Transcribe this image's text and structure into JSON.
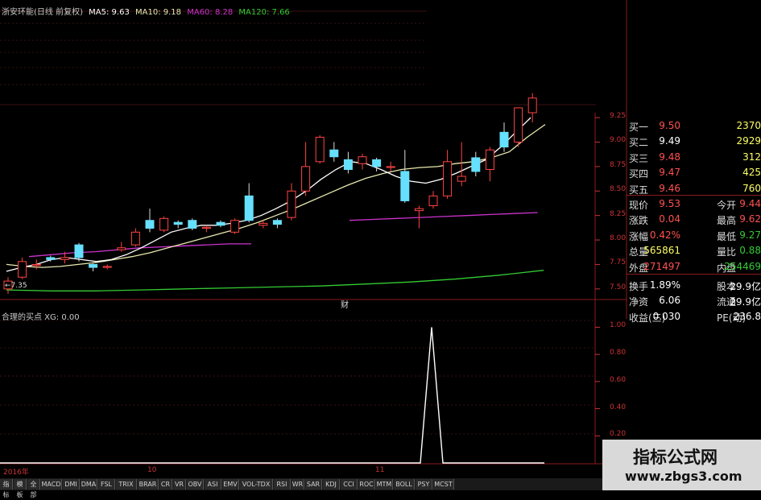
{
  "header": {
    "title": "浙安环能(日线 前复权)",
    "ma5": "MA5: 9.63",
    "ma10": "MA10: 9.18",
    "ma60": "MA60: 8.28",
    "ma120": "MA120: 7.66",
    "colors": {
      "title": "#c8c8c8",
      "ma5": "#ffffff",
      "ma10": "#e8e8b0",
      "ma60": "#cc33cc",
      "ma120": "#33cc33"
    }
  },
  "price_axis": [
    "9.25",
    "9.00",
    "8.75",
    "8.50",
    "8.25",
    "8.00",
    "7.75",
    "7.50"
  ],
  "low_marker": "←7.35",
  "finance_marker": "财",
  "indicator": {
    "title": "合理的买点 XG: 0.00",
    "axis": [
      "1.00",
      "0.80",
      "0.60",
      "0.40",
      "0.20"
    ]
  },
  "time_axis": {
    "year": "2016年",
    "months": [
      "10",
      "11"
    ]
  },
  "order_book": [
    {
      "label": "买一",
      "price": "9.50",
      "volume": "2370",
      "price_color": "#ff5050",
      "volume_color": "#ffff66"
    },
    {
      "label": "买二",
      "price": "9.49",
      "volume": "2929",
      "price_color": "#ffffff",
      "volume_color": "#ffff66"
    },
    {
      "label": "买三",
      "price": "9.48",
      "volume": "312",
      "price_color": "#ff5050",
      "volume_color": "#ffff66"
    },
    {
      "label": "买四",
      "price": "9.47",
      "volume": "425",
      "price_color": "#ff5050",
      "volume_color": "#ffff66"
    },
    {
      "label": "买五",
      "price": "9.46",
      "volume": "760",
      "price_color": "#ff5050",
      "volume_color": "#ffff66"
    }
  ],
  "quote": [
    {
      "l1": "现价",
      "v1": "9.53",
      "l2": "今开",
      "v2": "9.44",
      "c1": "#ff5050",
      "c2": "#ff5050"
    },
    {
      "l1": "涨跌",
      "v1": "0.04",
      "l2": "最高",
      "v2": "9.62",
      "c1": "#ff5050",
      "c2": "#ff5050"
    },
    {
      "l1": "涨幅",
      "v1": "0.42%",
      "l2": "最低",
      "v2": "9.27",
      "c1": "#ff5050",
      "c2": "#33cc33"
    },
    {
      "l1": "总量",
      "v1": "565861",
      "l2": "量比",
      "v2": "0.88",
      "c1": "#ffff66",
      "c2": "#33cc33"
    },
    {
      "l1": "外盘",
      "v1": "271497",
      "l2": "内盘",
      "v2": "254469",
      "c1": "#ff5050",
      "c2": "#33cc33"
    },
    {
      "l1": "换手",
      "v1": "1.89%",
      "l2": "股本",
      "v2": "29.9亿",
      "c1": "#ffffff",
      "c2": "#ffffff"
    },
    {
      "l1": "净资",
      "v1": "6.06",
      "l2": "流通",
      "v2": "29.9亿",
      "c1": "#ffffff",
      "c2": "#ffffff"
    },
    {
      "l1": "收益(三)",
      "v1": "0.030",
      "l2": "PE(动)",
      "v2": "236.8",
      "c1": "#ffffff",
      "c2": "#ffffff"
    }
  ],
  "tabs": [
    "指标",
    "模板",
    "全部",
    "MACD",
    "DMI",
    "DMA",
    "FSL",
    "TRIX",
    "BRAR",
    "CR",
    "VR",
    "OBV",
    "ASI",
    "EMV",
    "VOL-TDX",
    "RSI",
    "WR",
    "SAR",
    "KDJ",
    "CCI",
    "ROC",
    "MTM",
    "BOLL",
    "PSY",
    "MCST"
  ],
  "watermark": {
    "line1": "指标公式网",
    "line2": "www.zbgs3.com"
  },
  "chart_data": {
    "type": "candlestick",
    "price_ylim": [
      7.4,
      9.3
    ],
    "candles": [
      [
        7.5,
        7.58,
        7.45,
        7.62
      ],
      [
        7.62,
        7.78,
        7.6,
        7.82
      ],
      [
        7.75,
        7.75,
        7.7,
        7.8
      ],
      [
        7.82,
        7.8,
        7.78,
        7.84
      ],
      [
        7.8,
        7.82,
        7.76,
        7.88
      ],
      [
        7.95,
        7.82,
        7.78,
        7.97
      ],
      [
        7.75,
        7.72,
        7.68,
        7.76
      ],
      [
        7.72,
        7.73,
        7.7,
        7.75
      ],
      [
        7.9,
        7.92,
        7.88,
        7.98
      ],
      [
        7.95,
        8.08,
        7.93,
        8.12
      ],
      [
        8.2,
        8.12,
        8.08,
        8.32
      ],
      [
        8.1,
        8.22,
        8.08,
        8.24
      ],
      [
        8.18,
        8.16,
        8.12,
        8.2
      ],
      [
        8.2,
        8.12,
        8.1,
        8.22
      ],
      [
        8.12,
        8.13,
        8.08,
        8.15
      ],
      [
        8.18,
        8.15,
        8.13,
        8.2
      ],
      [
        8.08,
        8.2,
        8.06,
        8.22
      ],
      [
        8.45,
        8.2,
        8.18,
        8.58
      ],
      [
        8.15,
        8.17,
        8.12,
        8.2
      ],
      [
        8.2,
        8.16,
        8.12,
        8.22
      ],
      [
        8.23,
        8.5,
        8.2,
        8.58
      ],
      [
        8.5,
        8.75,
        8.45,
        9.0
      ],
      [
        8.8,
        9.05,
        8.78,
        9.07
      ],
      [
        8.92,
        8.85,
        8.8,
        9.0
      ],
      [
        8.82,
        8.72,
        8.68,
        8.9
      ],
      [
        8.78,
        8.85,
        8.72,
        8.88
      ],
      [
        8.82,
        8.75,
        8.7,
        8.84
      ],
      [
        8.75,
        8.75,
        8.7,
        8.8
      ],
      [
        8.7,
        8.4,
        8.38,
        8.92
      ],
      [
        8.3,
        8.32,
        8.12,
        8.35
      ],
      [
        8.35,
        8.45,
        8.32,
        8.5
      ],
      [
        8.45,
        8.8,
        8.42,
        8.92
      ],
      [
        8.6,
        8.65,
        8.55,
        9.0
      ],
      [
        8.84,
        8.7,
        8.65,
        8.9
      ],
      [
        8.72,
        8.92,
        8.6,
        8.95
      ],
      [
        9.1,
        8.95,
        8.9,
        9.2
      ],
      [
        9.0,
        9.35,
        8.95,
        9.35
      ],
      [
        9.3,
        9.45,
        9.2,
        9.5
      ]
    ],
    "ma5": [
      7.68,
      7.72,
      7.75,
      7.8,
      7.82,
      7.8,
      7.78,
      7.8,
      7.85,
      7.92,
      8.0,
      8.08,
      8.12,
      8.15,
      8.15,
      8.17,
      8.2,
      8.25,
      8.32,
      8.4,
      8.5,
      8.62,
      8.72,
      8.8,
      8.78,
      8.72,
      8.65,
      8.6,
      8.58,
      8.62,
      8.68,
      8.75,
      8.82,
      8.95,
      9.1,
      9.25
    ],
    "ma10": [
      7.75,
      7.73,
      7.72,
      7.73,
      7.75,
      7.77,
      7.8,
      7.83,
      7.87,
      7.92,
      7.97,
      8.02,
      8.07,
      8.12,
      8.18,
      8.25,
      8.32,
      8.4,
      8.48,
      8.56,
      8.63,
      8.68,
      8.72,
      8.74,
      8.75,
      8.78,
      8.8,
      8.84,
      8.9,
      9.05,
      9.18
    ],
    "ma60": [
      7.83,
      7.85,
      7.87,
      7.88,
      7.9,
      7.92,
      7.93,
      7.94,
      7.95,
      7.96,
      7.96
    ],
    "ma60_b": [
      8.2,
      8.21,
      8.22,
      8.23,
      8.24,
      8.25,
      8.26,
      8.27,
      8.28
    ],
    "ma120": [
      7.49,
      7.48,
      7.48,
      7.49,
      7.5,
      7.51,
      7.52,
      7.53,
      7.55,
      7.57,
      7.6,
      7.64,
      7.69
    ],
    "xg_ylim": [
      0,
      1.05
    ],
    "xg_signal": {
      "index": 31,
      "value": 1.0
    }
  }
}
